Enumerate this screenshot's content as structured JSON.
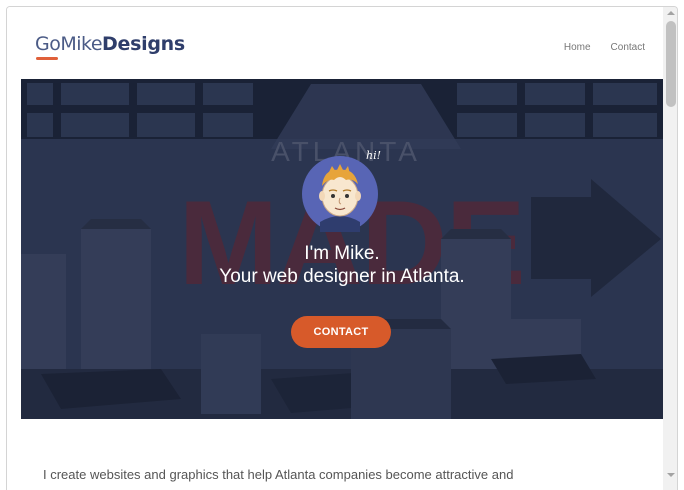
{
  "header": {
    "logo_part1": "GoMike",
    "logo_part2": "Designs",
    "nav": [
      {
        "label": "Home"
      },
      {
        "label": "Contact"
      }
    ]
  },
  "hero": {
    "mural_top_text": "ATLANTA",
    "mural_big_text": "MADE",
    "bubble_text": "hi!",
    "line1": "I'm Mike.",
    "line2": "Your web designer in Atlanta.",
    "cta_label": "CONTACT"
  },
  "intro": {
    "text": "I create websites and graphics that help Atlanta companies become attractive and"
  },
  "colors": {
    "accent": "#d75a2a",
    "brand_navy": "#2f3e6b",
    "hero_overlay": "#2b3550"
  },
  "icons": {
    "avatar": "cartoon-mike-avatar",
    "arrow": "mural-arrow"
  }
}
